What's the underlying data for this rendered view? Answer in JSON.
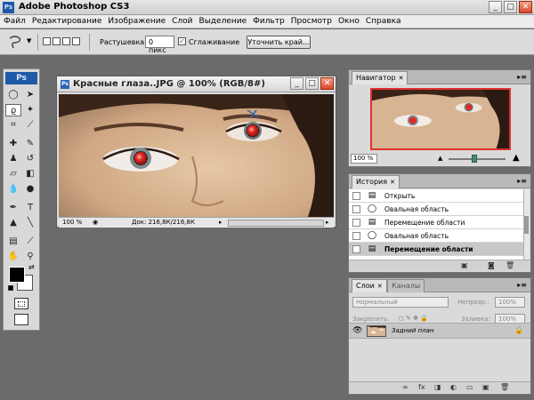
{
  "app": {
    "title": "Adobe Photoshop CS3",
    "ps_logo": "Ps",
    "window_controls": [
      "minimize-icon",
      "maximize-icon",
      "close-icon"
    ]
  },
  "menu": [
    "Файл",
    "Редактирование",
    "Изображение",
    "Слой",
    "Выделение",
    "Фильтр",
    "Просмотр",
    "Окно",
    "Справка"
  ],
  "options_bar": {
    "feather_label": "Растушевка:",
    "feather_value": "0 пикс",
    "antialias_label": "Сглаживание",
    "antialias_checked": true,
    "refine_edge_button": "Уточнить край..."
  },
  "document": {
    "title": "Красные глаза..JPG @ 100% (RGB/8#)",
    "zoom": "100 %",
    "doc_info": "Док: 216,8К/216,8К"
  },
  "navigator": {
    "tab": "Навигатор",
    "zoom": "100 %",
    "zoom_slider_level": 0.45
  },
  "history": {
    "tab": "История",
    "items": [
      {
        "label": "Открыть",
        "icon": "document-icon"
      },
      {
        "label": "Овальная область",
        "icon": "ellipse-select-icon"
      },
      {
        "label": "Перемещение области",
        "icon": "document-icon"
      },
      {
        "label": "Овальная область",
        "icon": "ellipse-select-icon"
      },
      {
        "label": "Перемещение области",
        "icon": "document-icon"
      }
    ],
    "selected_index": 4
  },
  "layers": {
    "tabs": [
      "Слои",
      "Каналы"
    ],
    "blend_mode": "Нормальный",
    "opacity_label": "Непрозр.:",
    "opacity_value": "100%",
    "lock_label": "Закрепить:",
    "fill_label": "Заливка:",
    "fill_value": "100%",
    "layer_name": "Задний план"
  },
  "colors": {
    "ps_blue": "#1e5aa8",
    "red_eye": "#e03030",
    "nav_frame": "#e03030"
  }
}
